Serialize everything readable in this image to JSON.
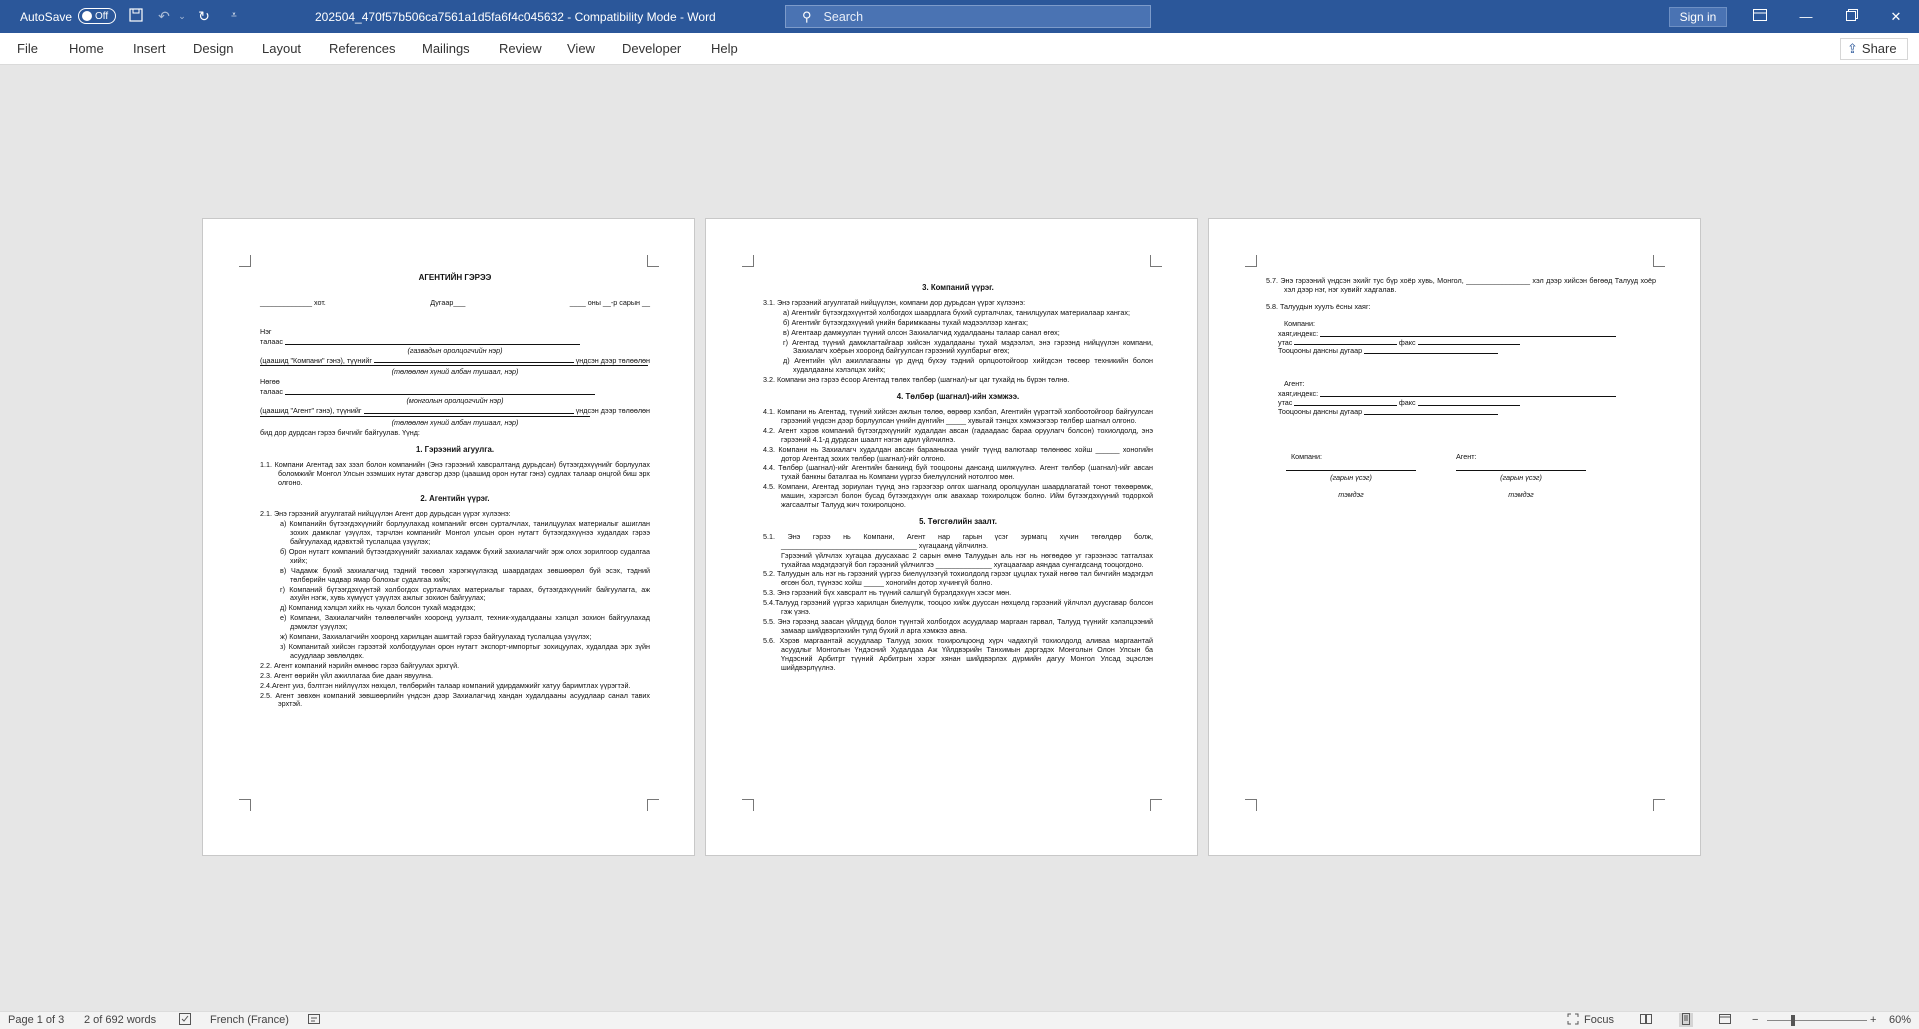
{
  "titlebar": {
    "autosave_label": "AutoSave",
    "autosave_state": "Off",
    "document_title": "202504_470f57b506ca7561a1d5fa6f4c045632  -  Compatibility Mode  -  Word",
    "search_placeholder": "Search",
    "signin_label": "Sign in",
    "icons": [
      "save-icon",
      "undo-icon",
      "redo-icon",
      "customize-icon",
      "ribbon-display-icon",
      "minimize-icon",
      "restore-icon",
      "close-icon"
    ]
  },
  "menu": {
    "items": [
      "File",
      "Home",
      "Insert",
      "Design",
      "Layout",
      "References",
      "Mailings",
      "Review",
      "View",
      "Developer",
      "Help"
    ],
    "share_label": "Share"
  },
  "page1": {
    "title": "АГЕНТИЙН ГЭРЭЭ",
    "place_line": "_____________ хот.",
    "number_line": "Дугаар___",
    "date_line": "____ оны __-р сарын __",
    "party1_a": "Нэг",
    "party1_b": "талаас",
    "party1_caption": "(газвадын оролцогчийн нэр)",
    "party1_desc_a": "(цаашид \"Компани\" гэнэ), түүнийг",
    "party1_desc_b": "үндсэн дээр төлөөлөн",
    "party1_caption2": "(төлөөлөн хүний албан тушаал, нэр)",
    "party2_a": "Нөгөө",
    "party2_b": "талаас",
    "party2_caption": "(монголын оролцогчийн нэр)",
    "party2_desc_a": "(цаашид \"Агент\" гэнэ), түүнийг",
    "party2_desc_b": "үндсэн дээр төлөөлөн",
    "party2_caption2": "(төлөөлөн хүний албан тушаал, нэр)",
    "intro_end": "бид дор дурдсан гэрээ бичгийг байгуулав. Үүнд:",
    "h1": "1. Гэрээний агуулга.",
    "p1_1": "1.1. Компани Агентад зах зээл болон компанийн (Энэ гэрээний хавсралтанд дурьдсан) бүтээгдэхүүнийг борлуулах боломжийг Монгол Улсын эзэмших нутаг дэвсгэр дээр (цаашид орон нутаг гэнэ) судлах талаар онцгой биш эрх олгоно.",
    "h2": "2. Агентийн үүрэг.",
    "p2_1": "2.1. Энэ гэрээний агуулгатай нийцүүлэн Агент дор дурьдсан үүрэг хүлээнэ:",
    "p2_1a": "а) Компанийн бүтээгдэхүүнийг борлуулахад компанийг өгсөн сурталчлах, танилцуулах материалыг ашиглан зохих дамжлаг үзүүлэх, тэрчлэн компанийг Монгол улсын орон нутагт бүтээгдэхүүнээ худалдах гэрээ байгуулахад идэвхтэй туслалцаа үзүүлэх;",
    "p2_1b": "б) Орон нутагт компаний бүтээгдэхүүнийг захиалах хадамж бүхий захиалагчийг эрж олох зорилгоор судалгаа хийх;",
    "p2_1c": "в) Чадамж бүхий захиалагчид тэдний төсөөл хэрэгжүүлэхэд шаардагдах зөвшөөрөл буй эсэх, тэдний төлбөрийн чадвар ямар болохыг судалгаа хийх;",
    "p2_1d": "г) Компаний бүтээгдэхүүнтэй холбогдох сурталчлах материалыг тараах, бүтээгдэхүүнийг байгуулагга, аж ахуйн нэгж, хувь хүмүүст үзүүлэх ажлыг зохион байгуулах;",
    "p2_1e": "д) Компанид хэлцэл хийх нь чухал болсон тухай мэдэгдэх;",
    "p2_1f": "е) Компани, Захиалагчийн төлөөлөгчийн хооронд уулзалт, техник-худалдааны хэлцэл зохион байгуулахад дэмжлэг үзүүлэх;",
    "p2_1g": "ж) Компани, Захиалагчийн хооронд харилцан ашигтай гэрээ байгуулахад туслалцаа үзүүлэх;",
    "p2_1h": "з) Компанитай хийсэн гэрээтэй холбогдуулан орон нутагт экспорт-импортыг зохицуулах, худалдаа эрх зүйн асуудлаар зөвлөлдөх.",
    "p2_2": "2.2. Агент компаний нэрийн өмнөөс гэрээ байгуулах эрхгүй.",
    "p2_3": "2.3. Агент өөрийн үйл ажиллагаа бие даан явуулна.",
    "p2_4": "2.4.Агент уиз, бэлтгэн нийлүүлэх нөхцөл, төлбөрийн талаар компаний удирдамжийг хатуу баримтлах үүрэгтэй.",
    "p2_5": "2.5. Агент зөвхөн компаний зөвшөөрлийн үндсэн дээр Захиалагчид хандан худалдааны асуудлаар санал тавих эрхтэй."
  },
  "page2": {
    "h3": "3. Компаний үүрэг.",
    "p3_1": "3.1. Энэ гэрээний агуулгатай нийцүүлэн, компани дор дурьдсан үүрэг хүлээнэ:",
    "p3_1a": "а) Агентийг бүтээгдэхүүнтэй холбогдох шаардлага бүхий сурталчлах, танилцуулах материалаар хангах;",
    "p3_1b": "б) Агентийг бүтээгдэхүүний үнийн баримжааны тухай мэдээллээр хангах;",
    "p3_1c": "в) Агентаар дамжуулан түүний олсон Захиалагчид худалдааны талаар санал өгөх;",
    "p3_1d": "г) Агентад түүний дамжлагтайгаар хийсэн худалдааны тухай мэдээлэл, энэ гэрээнд нийцүүлэн компани, Захиалагч хоёрын хооронд байгуулсан гэрээний хуулбарыг өгөх;",
    "p3_1e": "д) Агентийн үйл ажиллагааны үр дүнд бүхэу тэдний орлцоотойгоор хийгдсэн төсөөр техникийн болон худалдааны хэлэлцэх хийх;",
    "p3_2": "3.2. Компани энэ гэрээ ёсоор Агентад төлөх төлбөр (шагнал)-ыг цаг тухайд нь бүрэн төлнө.",
    "h4": "4. Төлбөр (шагнал)-ийн хэмжээ.",
    "p4_1": "4.1. Компани нь Агентад, түүний хийсэн ажлын төлөө, өөрөөр хэлбэл, Агентийн үүрэгтэй холбоотойгоор байгуулсан гэрээний үндсэн дээр борлуулсан үнийн дүнгийн _____ хувьтай тэнцэх хэмжээгээр төлбөр шагнал олгоно.",
    "p4_2": "4.2. Агент хэрэв компаний бүтээгдэхүүнийг худалдан авсан (гадаадаас бараа оруулагч болсон) тохиолдолд, энэ гэрээний 4.1-д дурдсан шаалт нэгэн адил үйлчилнэ.",
    "p4_3": "4.3. Компани нь Захиалагч худалдан авсан барааныхаа үнийг түүнд валютаар төлөнөөс хойш ______ хоногийн дотор Агентад зохих төлбөр (шагнал)-ийг олгоно.",
    "p4_4": "4.4. Төлбөр (шагнал)-ийг Агентийн банкинд буй тооцооны дансанд шилжүүлнэ. Агент төлбөр (шагнал)-ийг авсан тухай банкны баталгаа нь Компани үүргээ биелүүлсний нотолгоо мөн.",
    "p4_5": "4.5. Компани, Агентад зориулан түүнд энэ гэрээгээр олгох шагналд оролцуулан шаардлагатай тонот төхөөрөмж, машин, хэрэгсэл болон бусад бүтээгдэхүүн олж авахаар тохиролцож болно. Ийм бүтээгдэхүүний тодорхой жагсаалтыг Талууд жич тохиролцоно.",
    "h5": "5. Төгсгөлийн заалт.",
    "p5_1": "5.1. Энэ гэрээ нь Компани, Агент нар гарын үсэг зурмагц хүчин төгөлдөр болж, __________________________________ хүгацаанд үйлчилнэ.",
    "p5_1b": "Гэрээний үйлчлэх хугацаа дуусахаас 2 сарын өмнө Талуудын аль нэг нь нөгөөдөө уг гэрээнээс татгалзах тухайгаа мэдэгдээгүй бол гэрээний үйлчилгээ ______________ хугацаагаар аяндаа сунгагдсанд тооцогдоно.",
    "p5_2": "5.2. Талуудын аль нэг нь гэрээний үүргээ биелүүлээгүй тохиолдолд гэрээг цуцлах тухай нөгөө тал бичгийн мэдэгдэл өгсөн бол, түүнээс хойш _____ хоногийн дотор хүчингүй болно.",
    "p5_3": "5.3. Энэ гэрээний бүх хавсралт нь түүний салшгүй бүрэлдэхүүн хэсэг мөн.",
    "p5_4": "5.4.Талууд гэрээний үүргээ харилцан биелүүлж, тооцоо хийж дууссан нөхцөлд гэрээний үйлчлэл дуусгавар болсон гэж үзнэ.",
    "p5_5": "5.5. Энэ гэрээнд заасан үйлдүүд болон түүнтэй холбогдох асуудлаар маргаан гарвал, Талууд түүнийг хэлэлцээний замаар шийдвэрлэхийн тулд бүхий л арга хэмжээ авна.",
    "p5_6": "5.6. Хэрэв маргаантай асуудлаар Талууд зохих тохиролцоонд хүрч чадахгүй тохиолдолд аливаа маргаантай асуудлыг Монголын Үндэсний Худалдаа Аж Үйлдвэрийн Танхимын дэргэдэх Монголын Олон Улсын ба Үндэсний Арбитрт түүний Арбитрын хэрэг хянан шийдвэрлэх дүрмийн дагуу Монгол Улсад эцэслэн шийдвэрлүүлнэ."
  },
  "page3": {
    "p5_7": "5.7. Энэ гэрээний үндсэн эхийг тус бүр хоёр хувь, Монгол, ________________ хэл дээр хийсэн бөгөөд Талууд хоёр хэл дээр нэг, нэг хувийг хадгалав.",
    "p5_8": "5.8. Талуудын хуулъ ёсны хаяг:",
    "company_label": "Компани:",
    "address_label": "хаяг,индекс:",
    "phone_label": "утас",
    "fax_label": "факс",
    "account_label": "Тооцооны дансны дугаар",
    "agent_label": "Агент:",
    "sig_company": "Компани:",
    "sig_agent": "Агент:",
    "sig_caption": "(гарын үсэг)",
    "stamp_caption": "тэмдэг"
  },
  "status": {
    "page": "Page 1 of 3",
    "words": "2 of 692 words",
    "language": "French (France)",
    "focus": "Focus",
    "zoom_minus": "−",
    "zoom_plus": "+",
    "zoom": "60%"
  }
}
